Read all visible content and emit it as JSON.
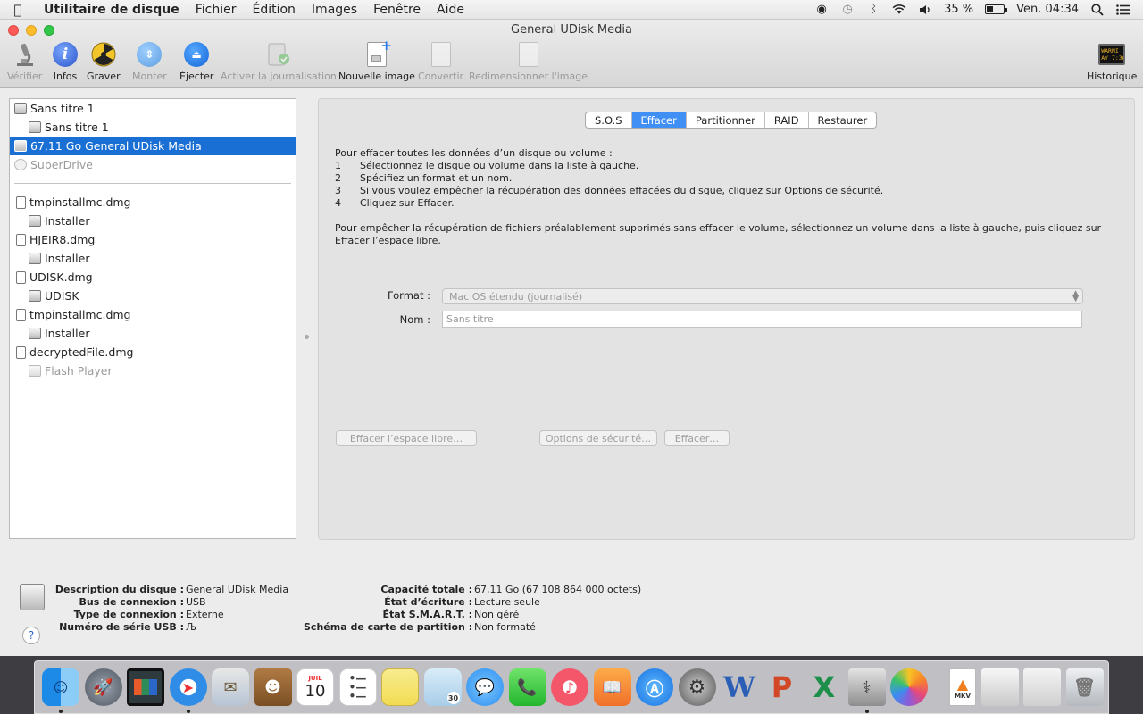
{
  "menubar": {
    "app": "Utilitaire de disque",
    "items": [
      "Fichier",
      "Édition",
      "Images",
      "Fenêtre",
      "Aide"
    ],
    "battery": "35 %",
    "battery_level": 0.35,
    "clock": "Ven. 04:34"
  },
  "window": {
    "title": "General UDisk Media"
  },
  "toolbar": {
    "verify": "Vérifier",
    "info": "Infos",
    "burn": "Graver",
    "mount": "Monter",
    "eject": "Éjecter",
    "journal": "Activer la journalisation",
    "new_image": "Nouvelle image",
    "convert": "Convertir",
    "resize": "Redimensionner l'image",
    "history": "Historique",
    "history_log_text": "WARNI",
    "history_log_text2": "AY 7:36"
  },
  "sidebar": {
    "items": [
      {
        "label": "Sans titre 1"
      },
      {
        "label": "Sans titre 1"
      },
      {
        "label": "67,11 Go General UDisk Media"
      },
      {
        "label": "SuperDrive"
      },
      {
        "label": "tmpinstallmc.dmg"
      },
      {
        "label": "Installer"
      },
      {
        "label": "HJEIR8.dmg"
      },
      {
        "label": "Installer"
      },
      {
        "label": "UDISK.dmg"
      },
      {
        "label": "UDISK"
      },
      {
        "label": "tmpinstallmc.dmg"
      },
      {
        "label": "Installer"
      },
      {
        "label": "decryptedFile.dmg"
      },
      {
        "label": "Flash Player"
      }
    ]
  },
  "tabs": [
    "S.O.S",
    "Effacer",
    "Partitionner",
    "RAID",
    "Restaurer"
  ],
  "erase": {
    "intro": "Pour effacer toutes les données d’un disque ou volume :",
    "steps": [
      {
        "n": "1",
        "text": "Sélectionnez le disque ou volume dans la liste à gauche."
      },
      {
        "n": "2",
        "text": "Spécifiez un format et un nom."
      },
      {
        "n": "3",
        "text": "Si vous voulez empêcher la récupération des données effacées du disque, cliquez sur Options de sécurité."
      },
      {
        "n": "4",
        "text": "Cliquez sur Effacer."
      }
    ],
    "para2": "Pour empêcher la récupération de fichiers préalablement supprimés sans effacer le volume, sélectionnez un volume dans la liste à gauche, puis cliquez sur Effacer l’espace libre.",
    "format_label": "Format :",
    "format_value": "Mac OS étendu (journalisé)",
    "name_label": "Nom :",
    "name_placeholder": "Sans titre",
    "btn_free": "Effacer l’espace libre…",
    "btn_security": "Options de sécurité…",
    "btn_erase": "Effacer…"
  },
  "info": {
    "left": [
      {
        "k": "Description du disque :",
        "v": "General UDisk Media"
      },
      {
        "k": "Bus de connexion :",
        "v": "USB"
      },
      {
        "k": "Type de connexion :",
        "v": "Externe"
      },
      {
        "k": "Numéro de série USB :",
        "v": "Љ"
      }
    ],
    "right": [
      {
        "k": "Capacité totale :",
        "v": "67,11 Go (67 108 864 000 octets)"
      },
      {
        "k": "État d’écriture :",
        "v": "Lecture seule"
      },
      {
        "k": "État S.M.A.R.T. :",
        "v": "Non géré"
      },
      {
        "k": "Schéma de carte de partition :",
        "v": "Non formaté"
      }
    ],
    "help": "?"
  },
  "dock": {
    "calendar_month": "JUIL",
    "calendar_day": "10",
    "word": "W",
    "powerpoint": "P",
    "excel": "X",
    "mkv": "MKV",
    "preview_badge": "30"
  },
  "colors": {
    "selection": "#1a6fd4",
    "tab_active": "#3f8ff5"
  }
}
